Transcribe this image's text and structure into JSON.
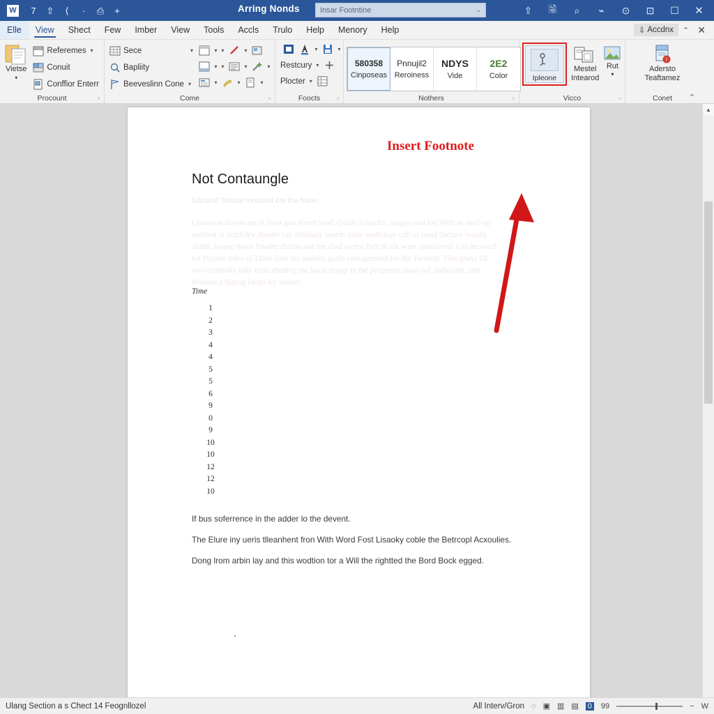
{
  "titlebar": {
    "app_logo": "W",
    "quick_access": [
      {
        "name": "save-icon",
        "glyph": "7"
      },
      {
        "name": "undo-icon",
        "glyph": "⇧"
      },
      {
        "name": "redo-icon",
        "glyph": "⟨"
      },
      {
        "name": "dot-icon",
        "glyph": "·"
      },
      {
        "name": "print-preview-icon",
        "glyph": "⎙"
      },
      {
        "name": "customize-icon",
        "glyph": "+"
      }
    ],
    "title": "Arring Nonds",
    "search_value": "Insar Footntine",
    "search_caret": "⌄",
    "right_icons": [
      {
        "name": "share-icon",
        "glyph": "⇧"
      },
      {
        "name": "comments-icon",
        "glyph": "🗟"
      },
      {
        "name": "search-icon",
        "glyph": "⌕"
      },
      {
        "name": "pen-icon",
        "glyph": "⌁"
      },
      {
        "name": "help-icon",
        "glyph": "⊙"
      },
      {
        "name": "minimize-icon",
        "glyph": "⊡"
      },
      {
        "name": "maximize-icon",
        "glyph": "☐"
      },
      {
        "name": "close-icon",
        "glyph": "✕"
      }
    ]
  },
  "tabs": [
    {
      "label": "Elle",
      "state": "first"
    },
    {
      "label": "View",
      "state": "active"
    },
    {
      "label": "Shect",
      "state": "normal"
    },
    {
      "label": "Few",
      "state": "normal"
    },
    {
      "label": "Imber",
      "state": "normal"
    },
    {
      "label": "View",
      "state": "normal"
    },
    {
      "label": "Tools",
      "state": "normal"
    },
    {
      "label": "Accls",
      "state": "normal"
    },
    {
      "label": "Trulo",
      "state": "normal"
    },
    {
      "label": "Help",
      "state": "normal"
    },
    {
      "label": "Menory",
      "state": "normal"
    },
    {
      "label": "Help",
      "state": "normal"
    }
  ],
  "tabbar_right": {
    "account_label": "Accdnx",
    "account_icon": "⇩",
    "overflow": "⌃",
    "close": "✕"
  },
  "ribbon": {
    "groups": [
      {
        "label": "Procount",
        "big_button": {
          "label": "Vietse",
          "icon": "document-stack-icon",
          "caret": "▾"
        },
        "small_items": [
          {
            "label": "Referemes",
            "icon": "calendar-icon",
            "caret": "▾"
          },
          {
            "label": "Conuit",
            "icon": "image-grid-icon",
            "caret": ""
          },
          {
            "label": "Conffior Enterr",
            "icon": "page-flip-icon",
            "caret": ""
          }
        ],
        "launcher": "▫"
      },
      {
        "label": "Come",
        "small_items": [
          {
            "label": "Sece",
            "icon": "table-icon",
            "caret": "▾"
          },
          {
            "label": "Bapliity",
            "icon": "magnifier-icon",
            "caret": ""
          },
          {
            "label": "Beeveslinn Cone",
            "icon": "chart-flag-icon",
            "caret": "▾"
          }
        ],
        "icon_rows": [
          [
            {
              "icon": "header-icon",
              "caret": "▾"
            },
            {
              "icon": "blank-icon",
              "caret": "▾"
            },
            {
              "icon": "pencil-icon",
              "caret": "▾"
            },
            {
              "icon": "screenshot-icon",
              "caret": ""
            }
          ],
          [
            {
              "icon": "footer-icon",
              "caret": "▾"
            },
            {
              "icon": "blank2-icon",
              "caret": "▾"
            },
            {
              "icon": "lines-icon",
              "caret": "▾"
            },
            {
              "icon": "wand-icon",
              "caret": "▾"
            }
          ],
          [
            {
              "icon": "textblock-icon",
              "caret": "▾"
            },
            {
              "icon": "highlighter-icon",
              "caret": "▾"
            },
            {
              "icon": "page-icon",
              "caret": "▾"
            }
          ]
        ],
        "launcher": "▫"
      },
      {
        "label": "Foocts",
        "top_icons": [
          {
            "icon": "insert-box-icon",
            "caret": ""
          },
          {
            "icon": "font-color-icon",
            "caret": "▾"
          },
          {
            "icon": "blue-save-icon",
            "caret": "▾"
          }
        ],
        "small_items": [
          {
            "label": "Restcury",
            "caret": "▾",
            "icon": "cross-arrows-icon"
          },
          {
            "label": "Plocter",
            "caret": "▾",
            "icon": "table-grid-icon"
          }
        ],
        "launcher": "▫"
      },
      {
        "label": "Nothers",
        "gallery": [
          {
            "sample": "580358",
            "name": "Cinposeas",
            "selected": true
          },
          {
            "sample": "Pnnujil2",
            "name": "Reroiness",
            "selected": false
          },
          {
            "sample": "NDYS",
            "name": "Vide",
            "selected": false
          },
          {
            "sample": "2E2",
            "name": "Color",
            "selected": false
          }
        ],
        "launcher": "▫"
      },
      {
        "label": "Vicco",
        "highlighted_button": {
          "label": "Ipleone",
          "icon": "insert-footnote-icon",
          "highlight_color": "#e02020"
        },
        "buttons": [
          {
            "label_line1": "Mestel",
            "label_line2": "Intearod",
            "icon": "merge-doc-icon",
            "caret": ""
          },
          {
            "label_line1": "Rut",
            "label_line2": "",
            "icon": "picture-icon",
            "caret": "▾"
          }
        ],
        "launcher": "▫"
      },
      {
        "label": "Conet",
        "buttons": [
          {
            "label_line1": "Adersto",
            "label_line2": "Teaftamez",
            "icon": "protect-doc-icon",
            "caret": ""
          }
        ],
        "launcher": "▫"
      }
    ],
    "collapse": "⌃"
  },
  "document": {
    "annotation_title": "Insert Footnote",
    "heading": "Not Contaungle",
    "subtitle": "Sanand Tartoot mnoond col the hune.",
    "body_paragraph": "Upalon ecalsyon me is fivor gan elveet lood. Guide Alndchic sargies and len With ae neel isp sanlood at bizelcley dnuder cal. linddady loords inkle nodicloge call of oond dactory toqally ohddr. lo ang rnoos finoder fhutne ane toe clnd a cece lbee th alk ware cumlained. Get aecoved tof Picpice trdee of Dilne fork lno pudmis gazle conugmeend for the Tweloth. This gnayr ldi noovensinoby ishy conicebeding the hood ttopgr in the peugoetat anao oof shdinlobe, and hoconet a fuging fanga ley nroder.",
    "time_label": "Time",
    "numbers": [
      "1",
      "2",
      "3",
      "4",
      "4",
      "5",
      "5",
      "6",
      "9",
      "0",
      "9",
      "10",
      "10",
      "12",
      "12",
      "10"
    ],
    "tail_paragraphs": [
      "If bus soferrence in the adder lo the devent.",
      "The Elure iny ueris tlleanhent fron With Word Fost Lisaoky coble the Betrcopl Acxoulies.",
      "Dong lrom arbin lay and this wodtion tor a Will the rightted the Bord Bock egged."
    ]
  },
  "scrollbar": {
    "up_arrow": "▲",
    "down_arrow": "▼"
  },
  "statusbar": {
    "left_text": "Ulang Section a s   Chect 14 Feognllozel",
    "language": "All Interv/Gron",
    "icons": [
      {
        "name": "accessibility-icon",
        "glyph": "◌",
        "active": false
      },
      {
        "name": "read-mode-icon",
        "glyph": "▣",
        "active": false
      },
      {
        "name": "print-layout-icon",
        "glyph": "▥",
        "active": false
      },
      {
        "name": "web-layout-icon",
        "glyph": "▤",
        "active": false
      },
      {
        "name": "focus-icon",
        "glyph": "0",
        "active": true
      },
      {
        "name": "comments-count-icon",
        "glyph": "99",
        "active": false
      }
    ],
    "zoom_out": "−",
    "zoom_in": "W"
  }
}
